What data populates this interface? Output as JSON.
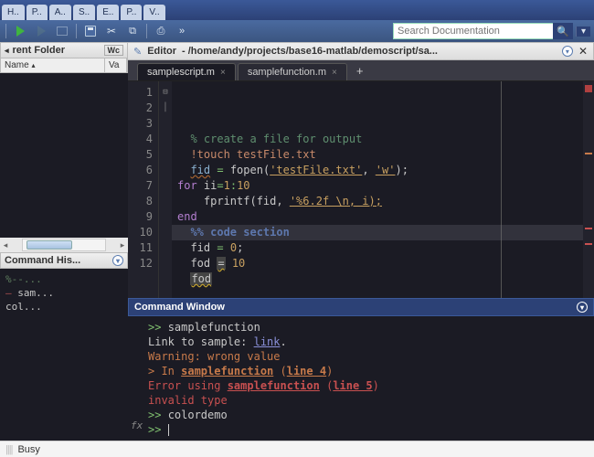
{
  "toolstrip_tabs": [
    "H..",
    "P..",
    "A..",
    "S..",
    "E..",
    "P..",
    "V.."
  ],
  "search": {
    "placeholder": "Search Documentation"
  },
  "panels": {
    "current_folder": {
      "title_visible": "rent Folder",
      "wrap_label": "Wc",
      "columns": {
        "name": "Name",
        "value": "Va"
      }
    },
    "command_history": {
      "title": "Command His...",
      "lines": [
        {
          "text": "%--...",
          "kind": "comment"
        },
        {
          "text": "sam...",
          "kind": "error"
        },
        {
          "text": "col...",
          "kind": "plain"
        }
      ]
    }
  },
  "editor": {
    "label": "Editor",
    "path": "- /home/andy/projects/base16-matlab/demoscript/sa...",
    "tabs": [
      {
        "name": "samplescript.m",
        "active": true
      },
      {
        "name": "samplefunction.m",
        "active": false
      }
    ],
    "highlight_line": 10,
    "lines": [
      {
        "n": 1,
        "seg": [
          [
            "  ",
            "p"
          ],
          [
            "% create a file for output",
            "comment"
          ]
        ]
      },
      {
        "n": 2,
        "seg": [
          [
            "  ",
            "p"
          ],
          [
            "!touch testFile.txt",
            "bang"
          ]
        ]
      },
      {
        "n": 3,
        "seg": [
          [
            "  ",
            "p"
          ],
          [
            "fid",
            "var"
          ],
          [
            " ",
            "p"
          ],
          [
            "=",
            "op"
          ],
          [
            " fopen(",
            "id"
          ],
          [
            "'testFile.txt'",
            "str2"
          ],
          [
            ", ",
            "id"
          ],
          [
            "'w'",
            "str2"
          ],
          [
            ");",
            "id"
          ]
        ]
      },
      {
        "n": 4,
        "fold": "⊟",
        "seg": [
          [
            "for",
            "kw"
          ],
          [
            " ii",
            "id"
          ],
          [
            "=",
            "op"
          ],
          [
            "1",
            "num"
          ],
          [
            ":",
            "op"
          ],
          [
            "10",
            "num"
          ]
        ]
      },
      {
        "n": 5,
        "fold": "│",
        "seg": [
          [
            "    fprintf(fid, ",
            "id"
          ],
          [
            "'%6.2f \\n, i);",
            "str"
          ]
        ]
      },
      {
        "n": 6,
        "seg": [
          [
            "end",
            "kw"
          ]
        ]
      },
      {
        "n": 7,
        "seg": [
          [
            "",
            "p"
          ]
        ]
      },
      {
        "n": 8,
        "seg": [
          [
            "  ",
            "p"
          ],
          [
            "%% code section",
            "sect"
          ]
        ]
      },
      {
        "n": 9,
        "seg": [
          [
            "  fid ",
            "id"
          ],
          [
            "=",
            "op"
          ],
          [
            " ",
            "p"
          ],
          [
            "0",
            "num"
          ],
          [
            ";",
            "id"
          ]
        ]
      },
      {
        "n": 10,
        "seg": [
          [
            "  fod ",
            "id"
          ],
          [
            "=",
            "warn"
          ],
          [
            " ",
            "p"
          ],
          [
            "10",
            "num"
          ]
        ]
      },
      {
        "n": 11,
        "seg": [
          [
            "  ",
            "p"
          ],
          [
            "fod",
            "warn"
          ]
        ]
      },
      {
        "n": 12,
        "seg": [
          [
            "",
            "p"
          ]
        ]
      }
    ]
  },
  "command_window": {
    "title": "Command Window",
    "lines": [
      {
        "seg": [
          [
            ">> ",
            "prompt"
          ],
          [
            "samplefunction",
            "id"
          ]
        ]
      },
      {
        "seg": [
          [
            "Link to sample: ",
            "id"
          ],
          [
            "link",
            "link"
          ],
          [
            ".",
            "id"
          ]
        ]
      },
      {
        "seg": [
          [
            "Warning: wrong value",
            "warn"
          ]
        ]
      },
      {
        "seg": [
          [
            "> In ",
            "warn"
          ],
          [
            "samplefunction",
            "warn u"
          ],
          [
            " (",
            "warn"
          ],
          [
            "line 4",
            "warn u"
          ],
          [
            ")",
            "warn"
          ]
        ]
      },
      {
        "seg": [
          [
            "Error using ",
            "err"
          ],
          [
            "samplefunction",
            "err u"
          ],
          [
            " (",
            "err"
          ],
          [
            "line 5",
            "err u"
          ],
          [
            ")",
            "err"
          ]
        ]
      },
      {
        "seg": [
          [
            "invalid type",
            "err"
          ]
        ]
      },
      {
        "seg": [
          [
            ">> ",
            "prompt"
          ],
          [
            "colordemo",
            "id"
          ]
        ]
      }
    ]
  },
  "status": {
    "text": "Busy"
  }
}
